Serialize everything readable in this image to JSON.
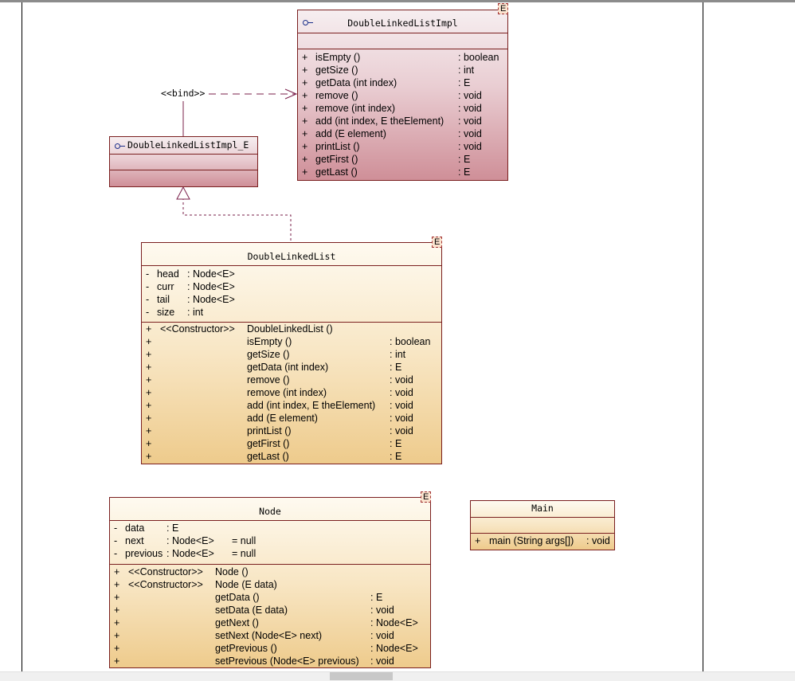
{
  "template_label": "E",
  "bind_label": "<<bind>>",
  "colors": {
    "border": "#7a1f1f",
    "interface_fill": "#d9a3aa",
    "class_fill": "#f3d8a8",
    "connector": "#7a1f4a"
  },
  "dll_impl": {
    "name": "DoubleLinkedListImpl",
    "methods": [
      {
        "vis": "+",
        "name": "isEmpty ()",
        "type": ": boolean"
      },
      {
        "vis": "+",
        "name": "getSize ()",
        "type": ": int"
      },
      {
        "vis": "+",
        "name": "getData (int index)",
        "type": ": E"
      },
      {
        "vis": "+",
        "name": "remove ()",
        "type": ": void"
      },
      {
        "vis": "+",
        "name": "remove (int index)",
        "type": ": void"
      },
      {
        "vis": "+",
        "name": "add (int index, E theElement)",
        "type": ": void"
      },
      {
        "vis": "+",
        "name": "add (E element)",
        "type": ": void"
      },
      {
        "vis": "+",
        "name": "printList ()",
        "type": ": void"
      },
      {
        "vis": "+",
        "name": "getFirst ()",
        "type": ": E"
      },
      {
        "vis": "+",
        "name": "getLast ()",
        "type": ": E"
      }
    ]
  },
  "dll_impl_e": {
    "name": "DoubleLinkedListImpl_E"
  },
  "dll": {
    "name": "DoubleLinkedList",
    "attributes": [
      {
        "vis": "-",
        "name": "head",
        "type": ": Node<E>"
      },
      {
        "vis": "-",
        "name": "curr",
        "type": ": Node<E>"
      },
      {
        "vis": "-",
        "name": "tail",
        "type": ": Node<E>"
      },
      {
        "vis": "-",
        "name": "size",
        "type": ": int"
      }
    ],
    "methods": [
      {
        "vis": "+",
        "stereo": "<<Constructor>>",
        "name": "DoubleLinkedList ()",
        "type": ""
      },
      {
        "vis": "+",
        "stereo": "",
        "name": "isEmpty ()",
        "type": ": boolean"
      },
      {
        "vis": "+",
        "stereo": "",
        "name": "getSize ()",
        "type": ": int"
      },
      {
        "vis": "+",
        "stereo": "",
        "name": "getData (int index)",
        "type": ": E"
      },
      {
        "vis": "+",
        "stereo": "",
        "name": "remove ()",
        "type": ": void"
      },
      {
        "vis": "+",
        "stereo": "",
        "name": "remove (int index)",
        "type": ": void"
      },
      {
        "vis": "+",
        "stereo": "",
        "name": "add (int index, E theElement)",
        "type": ": void"
      },
      {
        "vis": "+",
        "stereo": "",
        "name": "add (E element)",
        "type": ": void"
      },
      {
        "vis": "+",
        "stereo": "",
        "name": "printList ()",
        "type": ": void"
      },
      {
        "vis": "+",
        "stereo": "",
        "name": "getFirst ()",
        "type": ": E"
      },
      {
        "vis": "+",
        "stereo": "",
        "name": "getLast ()",
        "type": ": E"
      }
    ]
  },
  "node": {
    "name": "Node",
    "attributes": [
      {
        "vis": "-",
        "name": "data",
        "type": ": E",
        "default": ""
      },
      {
        "vis": "-",
        "name": "next",
        "type": ": Node<E>",
        "default": "= null"
      },
      {
        "vis": "-",
        "name": "previous",
        "type": ": Node<E>",
        "default": "= null"
      }
    ],
    "methods": [
      {
        "vis": "+",
        "stereo": "<<Constructor>>",
        "name": "Node ()",
        "type": ""
      },
      {
        "vis": "+",
        "stereo": "<<Constructor>>",
        "name": "Node (E data)",
        "type": ""
      },
      {
        "vis": "+",
        "stereo": "",
        "name": "getData ()",
        "type": ": E"
      },
      {
        "vis": "+",
        "stereo": "",
        "name": "setData (E data)",
        "type": ": void"
      },
      {
        "vis": "+",
        "stereo": "",
        "name": "getNext ()",
        "type": ": Node<E>"
      },
      {
        "vis": "+",
        "stereo": "",
        "name": "setNext (Node<E> next)",
        "type": ": void"
      },
      {
        "vis": "+",
        "stereo": "",
        "name": "getPrevious ()",
        "type": ": Node<E>"
      },
      {
        "vis": "+",
        "stereo": "",
        "name": "setPrevious (Node<E> previous)",
        "type": ": void"
      }
    ]
  },
  "main_cls": {
    "name": "Main",
    "methods": [
      {
        "vis": "+",
        "name": "main (String args[])",
        "type": ": void"
      }
    ]
  }
}
